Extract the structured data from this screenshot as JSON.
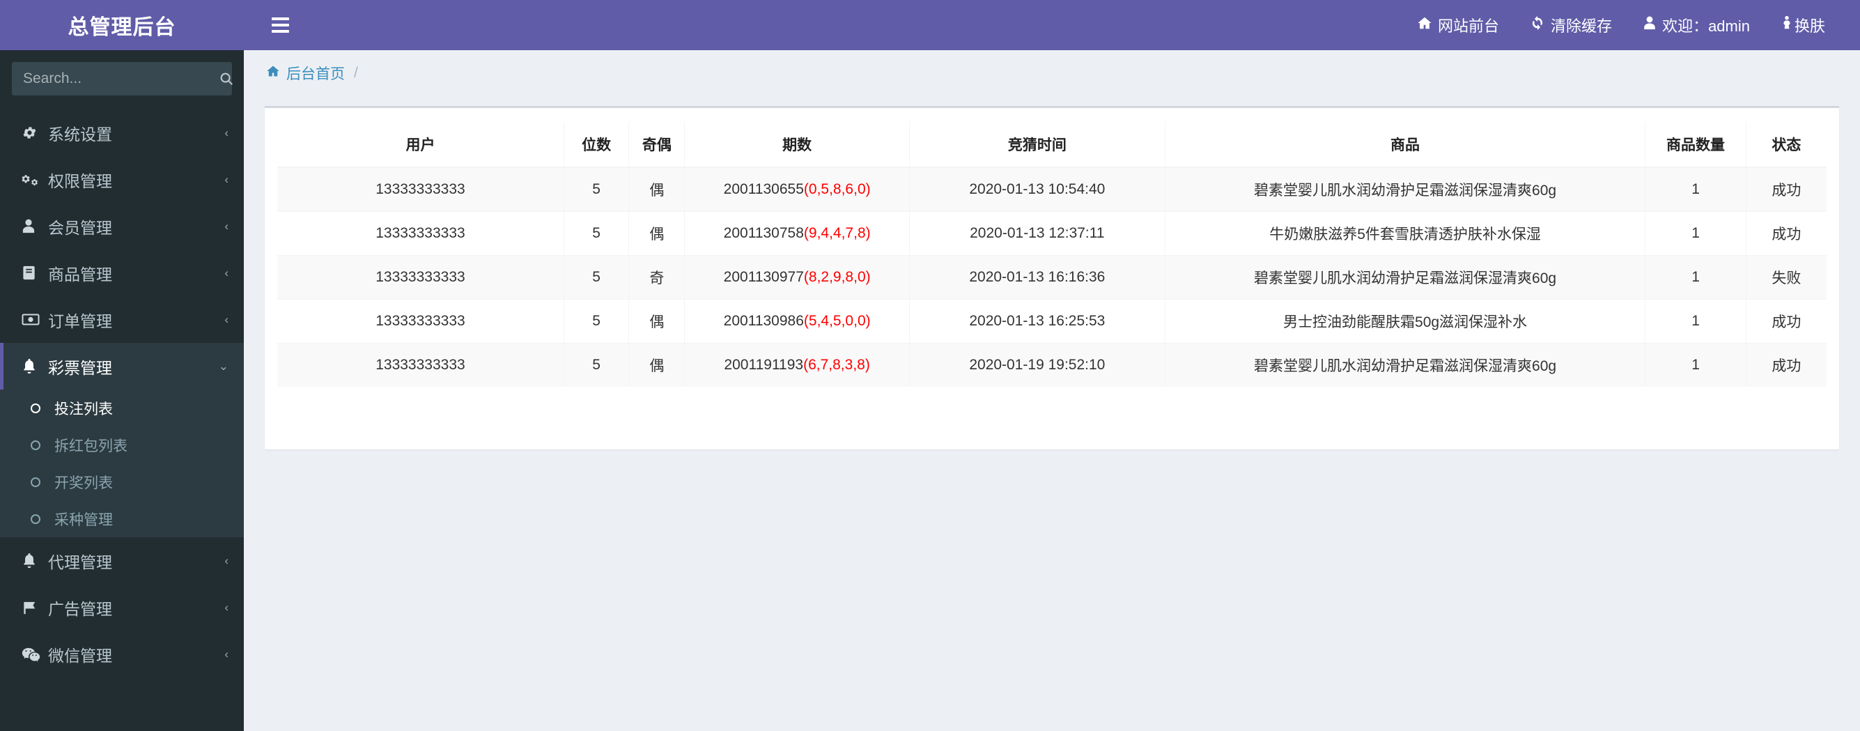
{
  "brand": {
    "title": "总管理后台"
  },
  "search": {
    "placeholder": "Search...",
    "value": "",
    "icon": "search-icon"
  },
  "sidebar": {
    "items": [
      {
        "label": "系统设置",
        "icon": "gear-icon",
        "arrow": "‹",
        "active": false
      },
      {
        "label": "权限管理",
        "icon": "gears-icon",
        "arrow": "‹",
        "active": false
      },
      {
        "label": "会员管理",
        "icon": "user-icon",
        "arrow": "‹",
        "active": false
      },
      {
        "label": "商品管理",
        "icon": "book-icon",
        "arrow": "‹",
        "active": false
      },
      {
        "label": "订单管理",
        "icon": "money-icon",
        "arrow": "‹",
        "active": false
      },
      {
        "label": "彩票管理",
        "icon": "bell-icon",
        "arrow": "⌄",
        "active": true
      },
      {
        "label": "代理管理",
        "icon": "bell-icon",
        "arrow": "‹",
        "active": false
      },
      {
        "label": "广告管理",
        "icon": "flag-icon",
        "arrow": "‹",
        "active": false
      },
      {
        "label": "微信管理",
        "icon": "wechat-icon",
        "arrow": "‹",
        "active": false
      }
    ],
    "submenu": [
      {
        "label": "投注列表",
        "icon": "circle-o-icon",
        "active": true
      },
      {
        "label": "拆红包列表",
        "icon": "circle-o-icon",
        "active": false
      },
      {
        "label": "开奖列表",
        "icon": "circle-o-icon",
        "active": false
      },
      {
        "label": "采种管理",
        "icon": "circle-o-icon",
        "active": false
      }
    ]
  },
  "navbar": {
    "menu_toggle": "hamburger-icon",
    "links": [
      {
        "label": "网站前台",
        "icon": "home-icon"
      },
      {
        "label": "清除缓存",
        "icon": "refresh-icon"
      },
      {
        "label": "欢迎：admin",
        "icon": "user-icon"
      },
      {
        "label": "换肤",
        "icon": "skin-icon"
      }
    ]
  },
  "breadcrumb": {
    "icon": "home-icon",
    "home": "后台首页",
    "separator": "/"
  },
  "table": {
    "headers": [
      "用户",
      "位数",
      "奇偶",
      "期数",
      "竞猜时间",
      "商品",
      "商品数量",
      "状态"
    ],
    "rows": [
      {
        "user": "13333333333",
        "digits": "5",
        "parity": "偶",
        "period_id": "2001130655",
        "period_nums": "(0,5,8,6,0)",
        "time": "2020-01-13 10:54:40",
        "goods": "碧素堂婴儿肌水润幼滑护足霜滋润保湿清爽60g",
        "qty": "1",
        "status": "成功"
      },
      {
        "user": "13333333333",
        "digits": "5",
        "parity": "偶",
        "period_id": "2001130758",
        "period_nums": "(9,4,4,7,8)",
        "time": "2020-01-13 12:37:11",
        "goods": "牛奶嫩肤滋养5件套雪肤清透护肤补水保湿",
        "qty": "1",
        "status": "成功"
      },
      {
        "user": "13333333333",
        "digits": "5",
        "parity": "奇",
        "period_id": "2001130977",
        "period_nums": "(8,2,9,8,0)",
        "time": "2020-01-13 16:16:36",
        "goods": "碧素堂婴儿肌水润幼滑护足霜滋润保湿清爽60g",
        "qty": "1",
        "status": "失败"
      },
      {
        "user": "13333333333",
        "digits": "5",
        "parity": "偶",
        "period_id": "2001130986",
        "period_nums": "(5,4,5,0,0)",
        "time": "2020-01-13 16:25:53",
        "goods": "男士控油劲能醒肤霜50g滋润保湿补水",
        "qty": "1",
        "status": "成功"
      },
      {
        "user": "13333333333",
        "digits": "5",
        "parity": "偶",
        "period_id": "2001191193",
        "period_nums": "(6,7,8,3,8)",
        "time": "2020-01-19 19:52:10",
        "goods": "碧素堂婴儿肌水润幼滑护足霜滋润保湿清爽60g",
        "qty": "1",
        "status": "成功"
      }
    ]
  },
  "colors": {
    "brand_purple": "#605ca8",
    "sidebar_dark": "#222d32",
    "sidebar_active": "#2c3b41",
    "link_blue": "#3c8dbc",
    "number_red": "#ff0000",
    "page_bg": "#ecf0f5"
  }
}
